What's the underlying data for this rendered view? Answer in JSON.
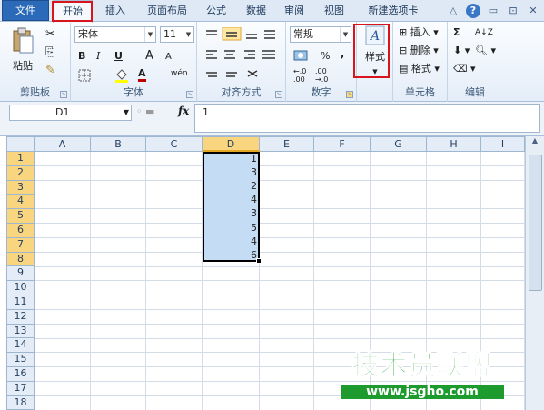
{
  "tabs": [
    {
      "label": "文件"
    },
    {
      "label": "开始"
    },
    {
      "label": "插入"
    },
    {
      "label": "页面布局"
    },
    {
      "label": "公式"
    },
    {
      "label": "数据"
    },
    {
      "label": "审阅"
    },
    {
      "label": "视图"
    },
    {
      "label": "新建选项卡"
    }
  ],
  "window_buttons": [
    "△",
    "?",
    "▭",
    "⊡",
    "✕"
  ],
  "clipboard": {
    "paste": "粘贴",
    "cut": "✂",
    "copy": "⎘",
    "brush": "✎",
    "label": "剪贴板"
  },
  "font": {
    "name": "宋体",
    "size": "11",
    "bold": "B",
    "italic": "I",
    "underline": "U",
    "grow": "A",
    "shrink": "A",
    "color_a": "A",
    "wen": "wén",
    "label": "字体",
    "accent_red": "#c00000"
  },
  "align": {
    "label": "对齐方式"
  },
  "number": {
    "format": "常规",
    "percent": "%",
    "comma": ",",
    "label": "数字"
  },
  "styles": {
    "label": "样式"
  },
  "cells": {
    "insert": "插入",
    "delete": "删除",
    "format": "格式",
    "label": "单元格"
  },
  "editing": {
    "sigma": "Σ",
    "sort": "A↓Z",
    "label": "编辑"
  },
  "formula_bar": {
    "name_box": "D1",
    "fx": "fx",
    "value": "1"
  },
  "columns": [
    "A",
    "B",
    "C",
    "D",
    "E",
    "F",
    "G",
    "H",
    "I"
  ],
  "rows": [
    "1",
    "2",
    "3",
    "4",
    "5",
    "6",
    "7",
    "8",
    "9",
    "10",
    "11",
    "12",
    "13",
    "14",
    "15",
    "16",
    "17",
    "18"
  ],
  "cells_d": [
    "1",
    "3",
    "2",
    "4",
    "3",
    "5",
    "4",
    "6"
  ],
  "watermark": {
    "title": "技术员联盟",
    "url": "www.jsgho.com"
  },
  "colors": {
    "selection": "#c5dcf5",
    "header_sel": "#f8d57e",
    "highlight": "#d8141c",
    "brand": "#1d9b2e"
  }
}
